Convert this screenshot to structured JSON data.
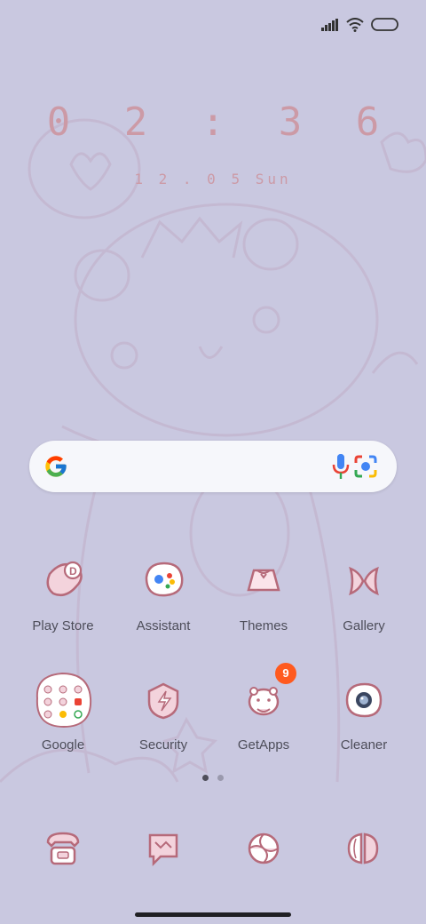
{
  "lock": {
    "time": "0 2 : 3 6",
    "date": "1 2 . 0 5  Sun"
  },
  "status": {
    "signal": "signal-icon",
    "wifi": "wifi-icon",
    "battery": "battery-icon"
  },
  "search": {
    "google_logo": "google-g-icon",
    "mic": "mic-icon",
    "lens": "lens-icon"
  },
  "apps": [
    {
      "label": "Play Store",
      "icon": "play-store-icon"
    },
    {
      "label": "Assistant",
      "icon": "assistant-icon"
    },
    {
      "label": "Themes",
      "icon": "themes-icon"
    },
    {
      "label": "Gallery",
      "icon": "gallery-icon"
    },
    {
      "label": "Google",
      "icon": "google-folder-icon"
    },
    {
      "label": "Security",
      "icon": "security-icon"
    },
    {
      "label": "GetApps",
      "icon": "getapps-icon",
      "badge": "9"
    },
    {
      "label": "Cleaner",
      "icon": "cleaner-icon"
    }
  ],
  "page_indicator": {
    "pages": 2,
    "current": 1
  },
  "dock": [
    "phone-icon",
    "messages-icon",
    "browser-icon",
    "camera-icon"
  ],
  "colors": {
    "background": "#c9c8e0",
    "clock": "#cc9aa6",
    "icon_stroke": "#b66a7a",
    "icon_fill": "#f3d3dc",
    "badge": "#ff5a1f"
  }
}
